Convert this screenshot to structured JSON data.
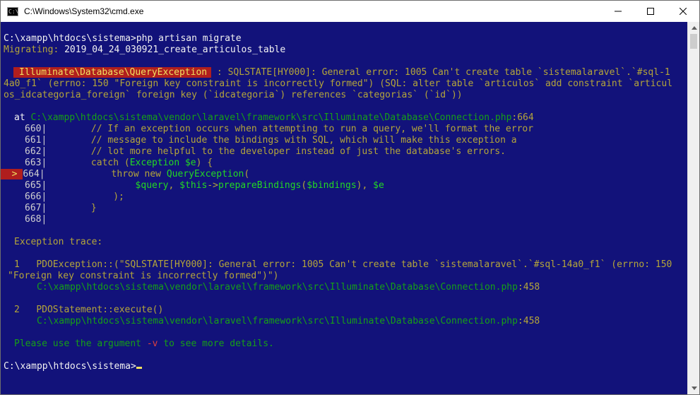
{
  "window": {
    "title": "C:\\Windows\\System32\\cmd.exe",
    "icon_text": "C:\\."
  },
  "console": {
    "line_top": "",
    "cmd_prompt": "C:\\xampp\\htdocs\\sistema>",
    "cmd_text": "php artisan migrate",
    "migrating_label": "Migrating:",
    "migrating_value": " 2019_04_24_030921_create_articulos_table",
    "exception_class": "Illuminate\\Database\\QueryException",
    "exception_msg_1": " : SQLSTATE[HY000]: General error: 1005 Can't create table `sistemalaravel`.`#sql-1",
    "exception_msg_2": "4a0_f1` (errno: 150 \"Foreign key constraint is incorrectly formed\") (SQL: alter table `articulos` add constraint `articul",
    "exception_msg_3": "os_idcategoria_foreign` foreign key (`idcategoria`) references `categorias` (`id`))",
    "at_label": "at ",
    "at_path": "C:\\xampp\\htdocs\\sistema\\vendor\\laravel\\framework\\src\\Illuminate\\Database\\Connection.php",
    "at_line": ":664",
    "code": [
      {
        "num": "660",
        "text": "        // If an exception occurs when attempting to run a query, we'll format the error"
      },
      {
        "num": "661",
        "text": "        // message to include the bindings with SQL, which will make this exception a"
      },
      {
        "num": "662",
        "text": "        // lot more helpful to the developer instead of just the database's errors."
      },
      {
        "num": "663",
        "pre": "        catch (",
        "kw": "Exception $e",
        "post": ") {"
      },
      {
        "num": "664",
        "arrow": ">",
        "pre": "            throw new ",
        "kw": "QueryException",
        "post": "("
      },
      {
        "num": "665",
        "pre": "                ",
        "v1": "$query",
        "c1": ", ",
        "v2": "$this",
        "c2": "->",
        "v3": "prepareBindings",
        "c3": "(",
        "v4": "$bindings",
        "c4": "), ",
        "v5": "$e"
      },
      {
        "num": "666",
        "text": "            );"
      },
      {
        "num": "667",
        "text": "        }"
      },
      {
        "num": "668",
        "text": ""
      }
    ],
    "trace_heading": "Exception trace:",
    "trace": [
      {
        "index": "1",
        "line_a": "PDOException::(\"SQLSTATE[HY000]: General error: 1005 Can't create table `sistemalaravel`.`#sql-14a0_f1` (errno: 150",
        "line_b": "\"Foreign key constraint is incorrectly formed\")\")",
        "path": "C:\\xampp\\htdocs\\sistema\\vendor\\laravel\\framework\\src\\Illuminate\\Database\\Connection.php",
        "line": ":458"
      },
      {
        "index": "2",
        "line_a": "PDOStatement::execute()",
        "path": "C:\\xampp\\htdocs\\sistema\\vendor\\laravel\\framework\\src\\Illuminate\\Database\\Connection.php",
        "line": ":458"
      }
    ],
    "hint_pre": "Please use the argument ",
    "hint_flag": "-v",
    "hint_post": " to see more details.",
    "final_prompt": "C:\\xampp\\htdocs\\sistema>"
  },
  "colors": {
    "console_bg": "#12127a",
    "badge_bg": "#b01e1e",
    "badge_fg": "#f0e060",
    "green": "#16a016",
    "olive": "#b4a53a"
  }
}
